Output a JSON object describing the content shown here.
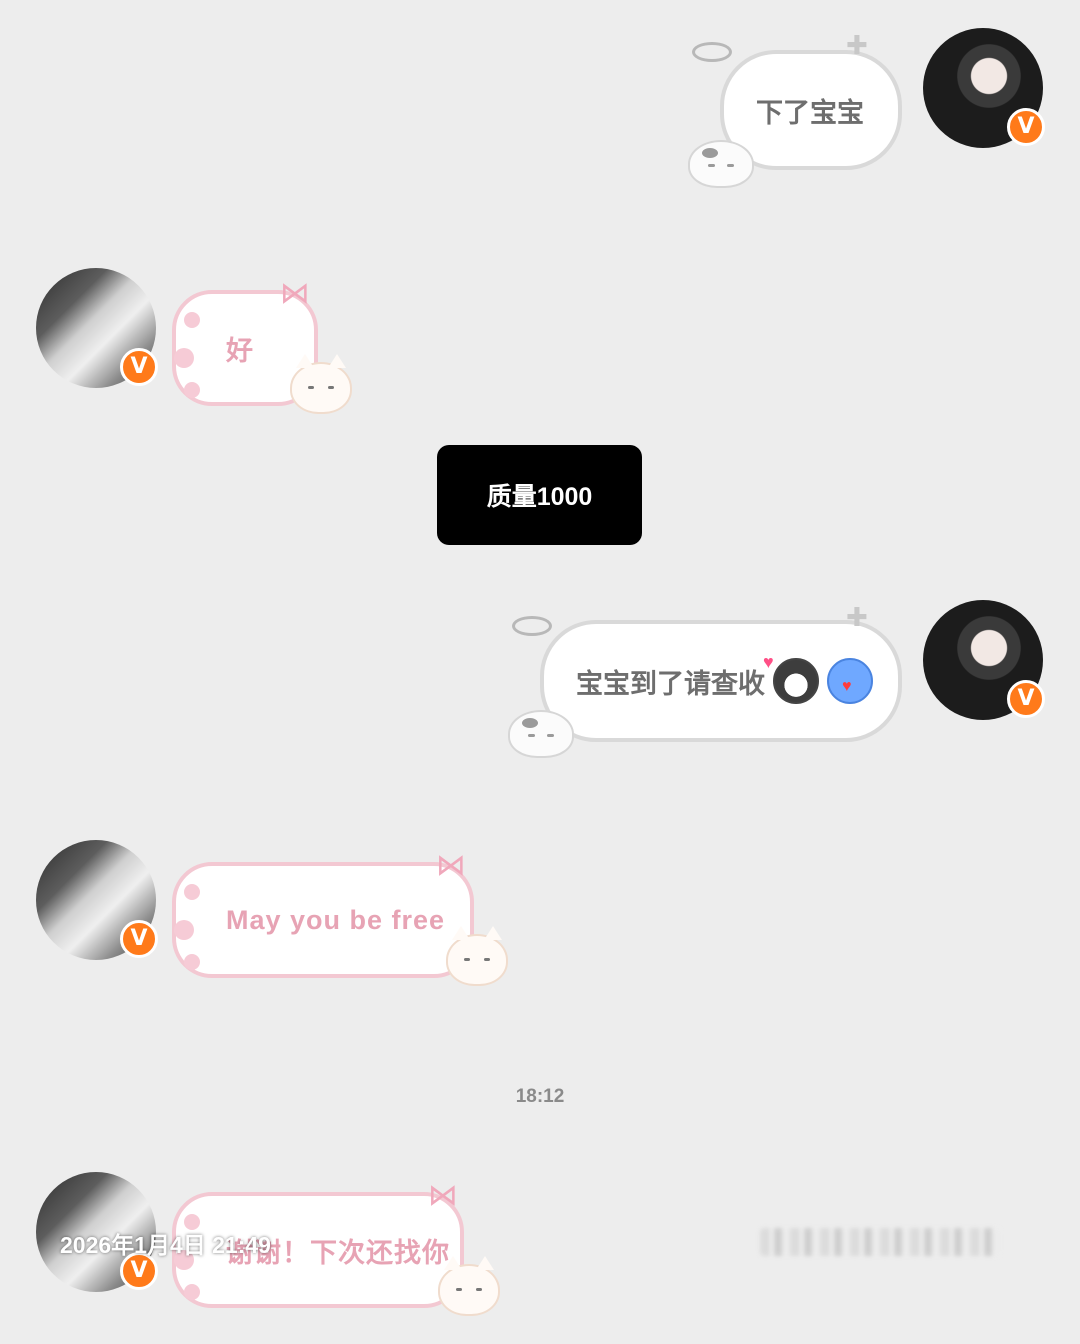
{
  "messages": [
    {
      "side": "right",
      "text": "下了宝宝"
    },
    {
      "side": "left",
      "text": "好"
    },
    {
      "side": "right",
      "text": "宝宝到了请查收",
      "emojis": [
        "cat-heart-emoji",
        "blue-heart-emoji"
      ]
    },
    {
      "side": "left",
      "text": "May you be free"
    },
    {
      "side": "left",
      "text": "谢谢！下次还找你"
    }
  ],
  "notice": {
    "text": "质量1000"
  },
  "timestamp": {
    "text": "18:12"
  },
  "watermark": {
    "text": "2026年1月4日 21:49"
  },
  "badge": {
    "label": "V",
    "color": "#ff7a1a"
  },
  "colors": {
    "background": "#ededed",
    "pink_text": "#e7a3b4",
    "grey_text": "#6e6e6e"
  }
}
